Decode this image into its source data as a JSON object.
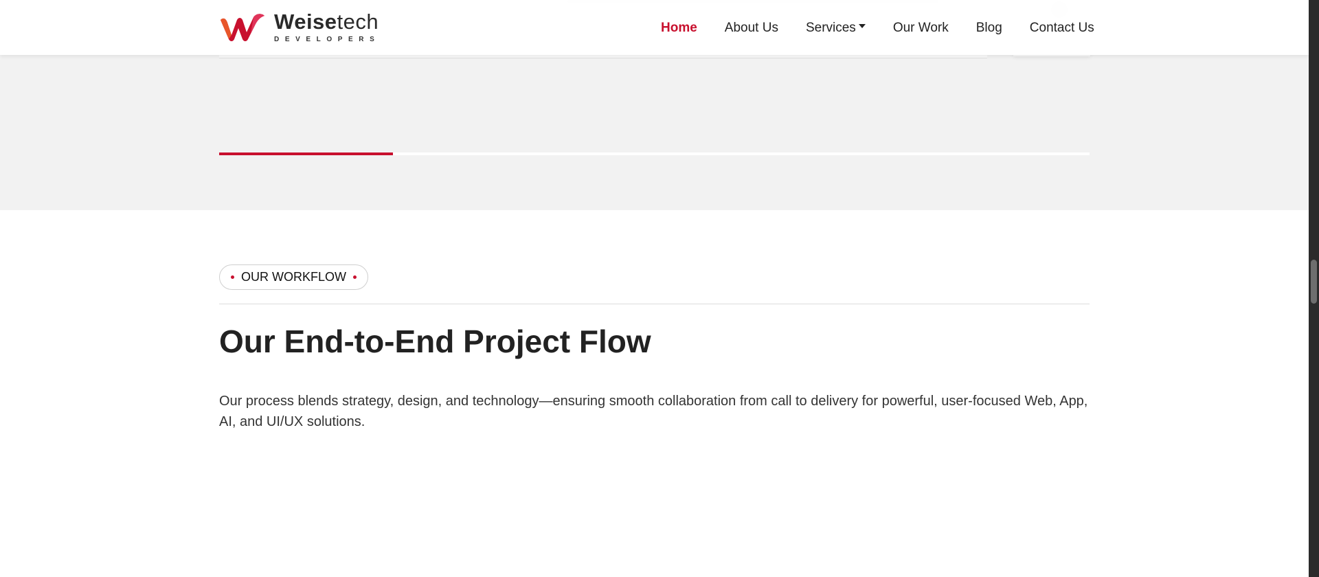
{
  "header": {
    "logo": {
      "name_bold": "Weise",
      "name_regular": "tech",
      "tagline": "DEVELOPERS"
    },
    "nav": [
      {
        "label": "Home",
        "active": true
      },
      {
        "label": "About Us"
      },
      {
        "label": "Services",
        "has_dropdown": true
      },
      {
        "label": "Our Work"
      },
      {
        "label": "Blog"
      },
      {
        "label": "Contact Us"
      }
    ]
  },
  "slider": {
    "progress_percent": 20
  },
  "workflow": {
    "badge": "OUR WORKFLOW",
    "title": "Our End-to-End Project Flow",
    "description": "Our process blends strategy, design, and technology—ensuring smooth collaboration from call to delivery for powerful, user-focused Web, App, AI, and UI/UX solutions."
  },
  "colors": {
    "accent": "#c8102e",
    "band_background": "#f2f2f2"
  },
  "icons": [
    "weisetech-logo-icon",
    "chevron-down-icon"
  ]
}
